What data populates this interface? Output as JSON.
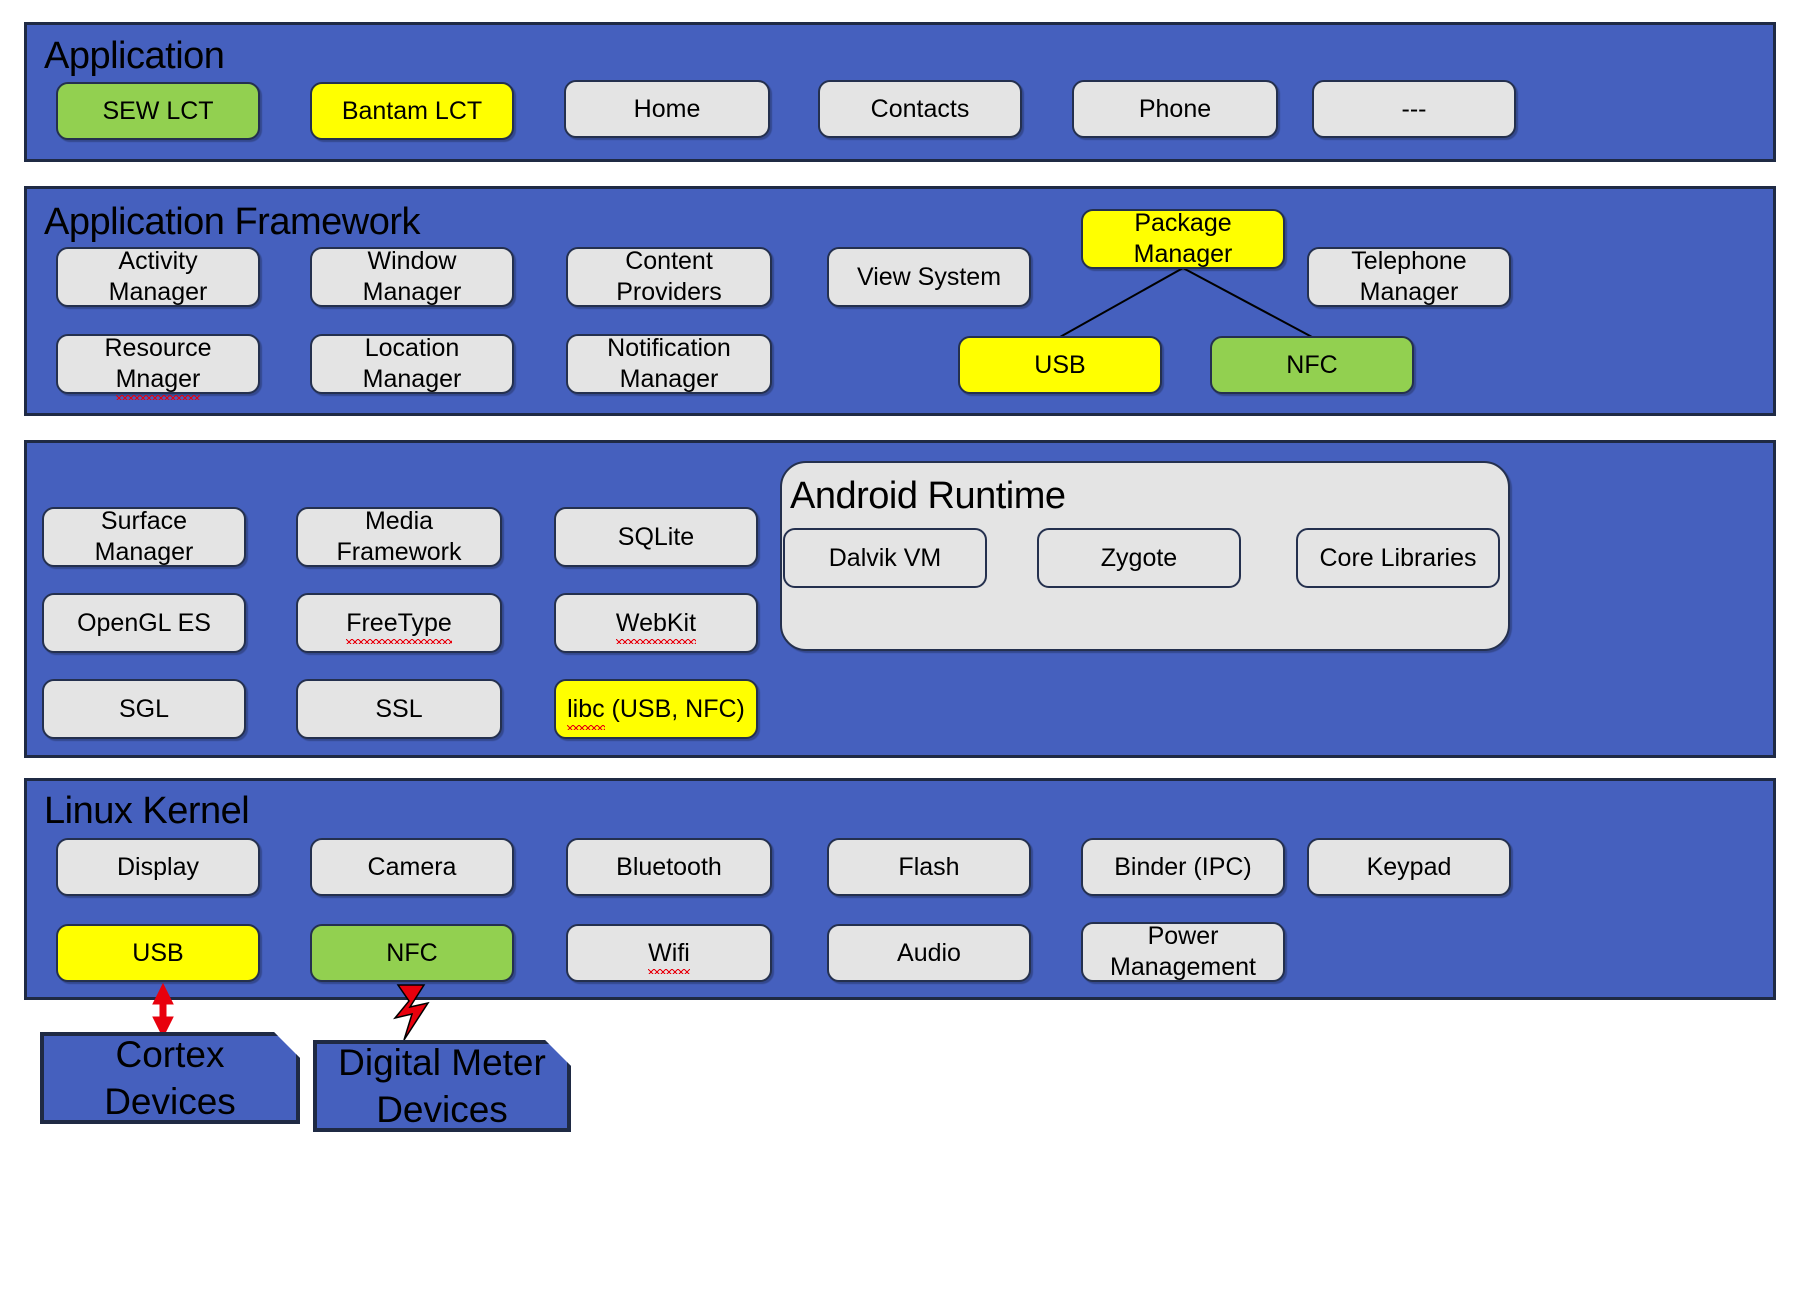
{
  "diagram": {
    "title": "Android Software Stack with SEW/Bantam LCT, USB and NFC highlights",
    "colors": {
      "layer_band": "#4560BE",
      "node_default": "#E4E4E4",
      "node_yellow": "#FFFF00",
      "node_green": "#92D050",
      "outline": "#24304E",
      "arrow_red": "#E8000D",
      "spellcheck_underline": "#E8000D"
    }
  },
  "layers": [
    {
      "id": "application",
      "title": "Application",
      "nodes": [
        {
          "label": "SEW LCT",
          "color": "green"
        },
        {
          "label": "Bantam LCT",
          "color": "yellow"
        },
        {
          "label": "Home",
          "color": "gray"
        },
        {
          "label": "Contacts",
          "color": "gray"
        },
        {
          "label": "Phone",
          "color": "gray"
        },
        {
          "label": "---",
          "color": "gray"
        }
      ]
    },
    {
      "id": "application-framework",
      "title": "Application Framework",
      "nodes": [
        {
          "label": "Activity\nManager",
          "color": "gray"
        },
        {
          "label": "Window\nManager",
          "color": "gray"
        },
        {
          "label": "Content\nProviders",
          "color": "gray"
        },
        {
          "label": "View System",
          "color": "gray"
        },
        {
          "label": "Package\nManager",
          "color": "yellow"
        },
        {
          "label": "Telephone\nManager",
          "color": "gray"
        },
        {
          "label": "Resource\nMnager",
          "color": "gray",
          "misspelled_word": "Mnager"
        },
        {
          "label": "Location\nManager",
          "color": "gray"
        },
        {
          "label": "Notification\nManager",
          "color": "gray"
        },
        {
          "label": "USB",
          "color": "yellow"
        },
        {
          "label": "NFC",
          "color": "green"
        }
      ],
      "connections": [
        {
          "from": "Package Manager",
          "to": "USB"
        },
        {
          "from": "Package Manager",
          "to": "NFC"
        }
      ]
    },
    {
      "id": "libraries",
      "title": "",
      "nodes": [
        {
          "label": "Surface\nManager",
          "color": "gray"
        },
        {
          "label": "Media\nFramework",
          "color": "gray"
        },
        {
          "label": "SQLite",
          "color": "gray"
        },
        {
          "label": "OpenGL ES",
          "color": "gray"
        },
        {
          "label": "FreeType",
          "color": "gray",
          "misspelled_word": "FreeType"
        },
        {
          "label": "WebKit",
          "color": "gray",
          "misspelled_word": "WebKit"
        },
        {
          "label": "SGL",
          "color": "gray"
        },
        {
          "label": "SSL",
          "color": "gray"
        },
        {
          "label": "libc (USB, NFC)",
          "color": "yellow",
          "misspelled_word": "libc"
        }
      ],
      "runtime": {
        "title": "Android Runtime",
        "nodes": [
          {
            "label": "Dalvik VM"
          },
          {
            "label": "Zygote"
          },
          {
            "label": "Core Libraries"
          }
        ]
      }
    },
    {
      "id": "linux-kernel",
      "title": "Linux Kernel",
      "nodes": [
        {
          "label": "Display",
          "color": "gray"
        },
        {
          "label": "Camera",
          "color": "gray"
        },
        {
          "label": "Bluetooth",
          "color": "gray"
        },
        {
          "label": "Flash",
          "color": "gray"
        },
        {
          "label": "Binder (IPC)",
          "color": "gray"
        },
        {
          "label": "Keypad",
          "color": "gray"
        },
        {
          "label": "USB",
          "color": "yellow"
        },
        {
          "label": "NFC",
          "color": "green"
        },
        {
          "label": "Wifi",
          "color": "gray",
          "misspelled_word": "Wifi"
        },
        {
          "label": "Audio",
          "color": "gray"
        },
        {
          "label": "Power\nManagement",
          "color": "gray"
        }
      ]
    }
  ],
  "devices": [
    {
      "label": "Cortex\nDevices",
      "connector": "double-headed-red-arrow",
      "connects_to": "USB"
    },
    {
      "label": "Digital Meter\nDevices",
      "connector": "red-lightning-bolt",
      "connects_to": "NFC"
    }
  ],
  "text": {
    "app_title": "Application",
    "framework_title": "Application Framework",
    "kernel_title": "Linux Kernel",
    "runtime_title": "Android Runtime",
    "n": {
      "sew_lct": "SEW LCT",
      "bantam_lct": "Bantam LCT",
      "home": "Home",
      "contacts": "Contacts",
      "phone": "Phone",
      "ellipsis": "---",
      "activity_1": "Activity",
      "activity_2": "Manager",
      "window_1": "Window",
      "window_2": "Manager",
      "content_1": "Content",
      "content_2": "Providers",
      "view_system": "View System",
      "package_1": "Package",
      "package_2": "Manager",
      "telephone_1": "Telephone",
      "telephone_2": "Manager",
      "resource_1": "Resource",
      "resource_2": "Mnager",
      "location_1": "Location",
      "location_2": "Manager",
      "notification_1": "Notification",
      "notification_2": "Manager",
      "fw_usb": "USB",
      "fw_nfc": "NFC",
      "surface_1": "Surface",
      "surface_2": "Manager",
      "media_1": "Media",
      "media_2": "Framework",
      "sqlite": "SQLite",
      "opengl": "OpenGL ES",
      "freetype": "FreeType",
      "webkit": "WebKit",
      "sgl": "SGL",
      "ssl": "SSL",
      "libc_name": "libc",
      "libc_rest": " (USB, NFC)",
      "dalvik": "Dalvik VM",
      "zygote": "Zygote",
      "core_libraries": "Core Libraries",
      "display": "Display",
      "camera": "Camera",
      "bluetooth": "Bluetooth",
      "flash": "Flash",
      "binder": "Binder (IPC)",
      "keypad": "Keypad",
      "k_usb": "USB",
      "k_nfc": "NFC",
      "wifi": "Wifi",
      "audio": "Audio",
      "power_1": "Power",
      "power_2": "Management",
      "cortex_1": "Cortex",
      "cortex_2": "Devices",
      "meter_1": "Digital Meter",
      "meter_2": "Devices"
    }
  }
}
